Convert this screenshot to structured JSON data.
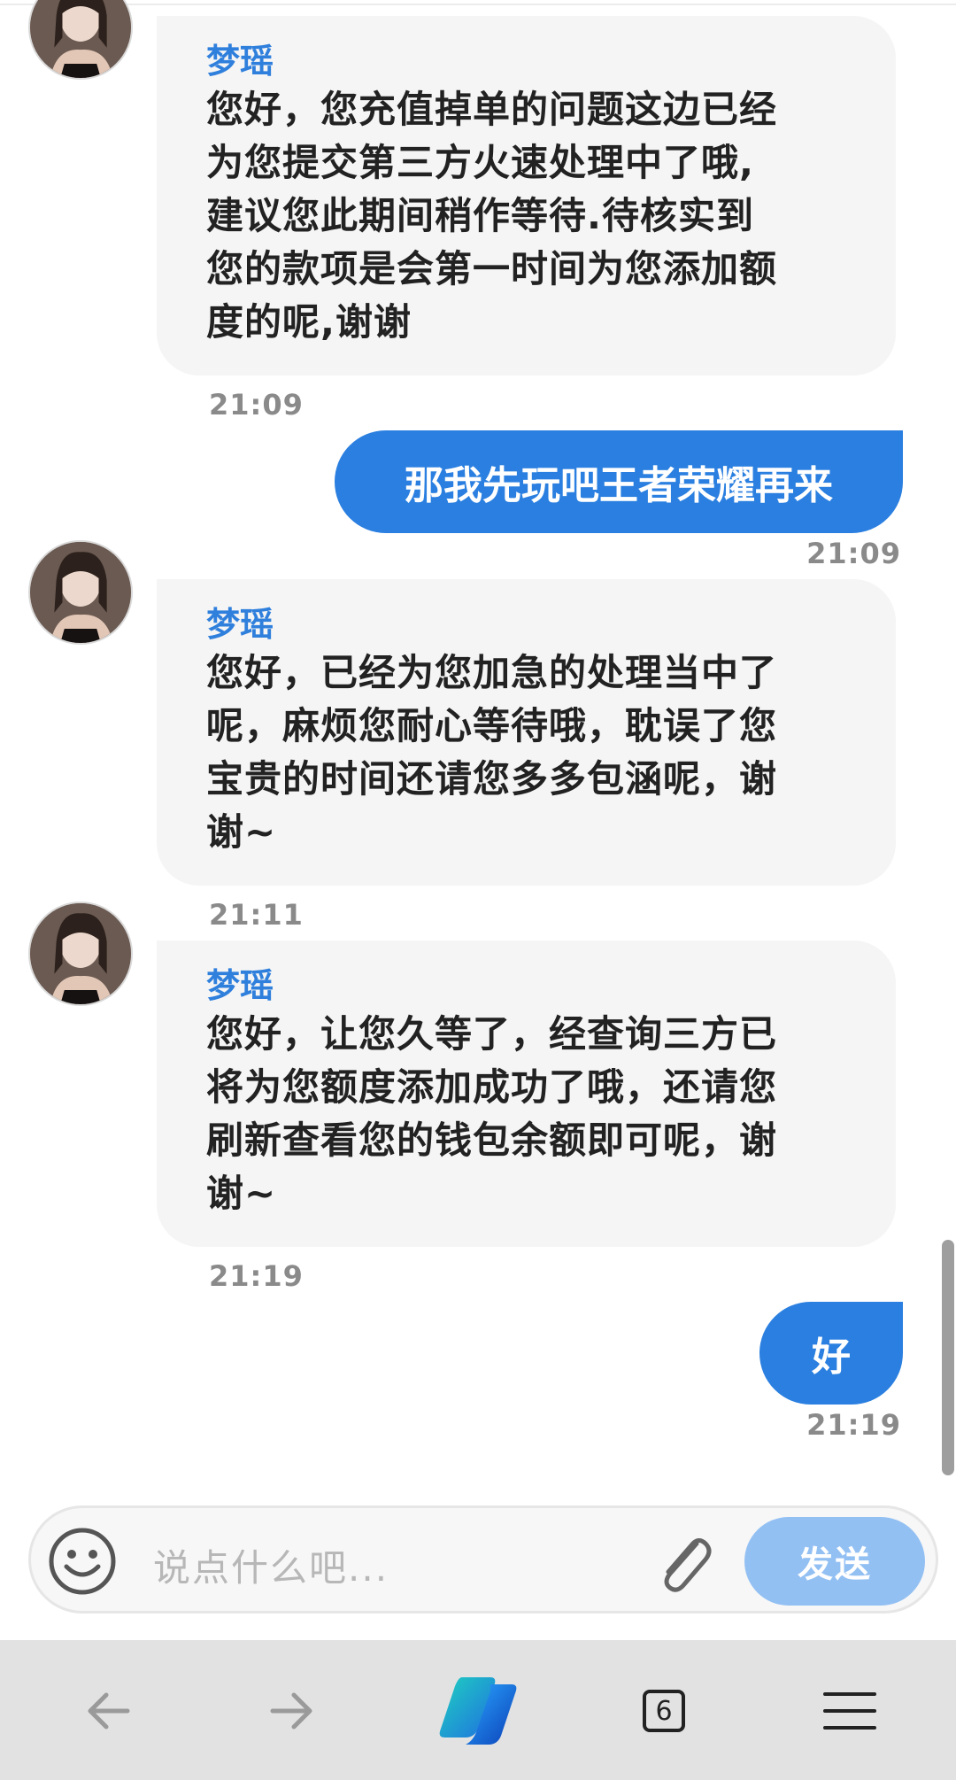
{
  "messages": [
    {
      "sender": "梦瑶",
      "lines": [
        "您好，您充值掉单的问题这边已经",
        "为您提交第三方火速处理中了哦,",
        "建议您此期间稍作等待.待核实到",
        "您的款项是会第一时间为您添加额",
        "度的呢,谢谢"
      ],
      "time": "21:09"
    },
    {
      "outgoing_text": "那我先玩吧王者荣耀再来",
      "time": "21:09"
    },
    {
      "sender": "梦瑶",
      "lines": [
        "您好，已经为您加急的处理当中了",
        "呢，麻烦您耐心等待哦，耽误了您",
        "宝贵的时间还请您多多包涵呢，谢",
        "谢~"
      ],
      "time": "21:11"
    },
    {
      "sender": "梦瑶",
      "lines": [
        "您好，让您久等了，经查询三方已",
        "将为您额度添加成功了哦，还请您",
        "刷新查看您的钱包余额即可呢，谢",
        "谢~"
      ],
      "time": "21:19"
    },
    {
      "outgoing_text": "好",
      "time": "21:19"
    }
  ],
  "input": {
    "placeholder": "说点什么吧...",
    "send_label": "发送"
  },
  "browser_nav": {
    "tab_count": "6",
    "icons": [
      "back-arrow-icon",
      "forward-arrow-icon",
      "copilot-icon",
      "tabs-icon",
      "menu-icon"
    ]
  },
  "colors": {
    "accent": "#2a7fe0",
    "sender_name": "#2f7fdc",
    "incoming_bubble": "#f5f5f5",
    "send_button_disabled": "#93c0f3"
  }
}
